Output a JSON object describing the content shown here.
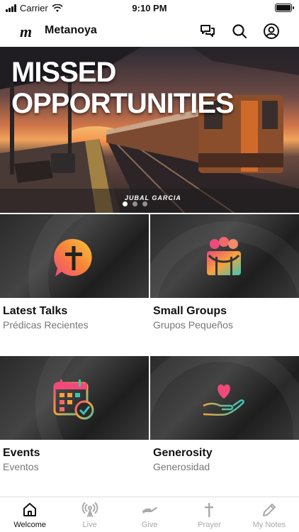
{
  "status_bar": {
    "carrier": "Carrier",
    "time": "9:10 PM"
  },
  "header": {
    "logo": "m",
    "title": "Metanoya"
  },
  "hero": {
    "title_line1": "MISSED",
    "title_line2": "OPPORTUNITIES",
    "credit": "JUBAL GARCIA",
    "page_count": 3,
    "active_page": 1
  },
  "tiles": [
    {
      "title": "Latest Talks",
      "subtitle": "Prédicas Recientes",
      "icon": "speech-cross-icon"
    },
    {
      "title": "Small Groups",
      "subtitle": "Grupos Pequeños",
      "icon": "group-hug-icon"
    },
    {
      "title": "Events",
      "subtitle": "Eventos",
      "icon": "calendar-check-icon"
    },
    {
      "title": "Generosity",
      "subtitle": "Generosidad",
      "icon": "heart-hand-icon"
    }
  ],
  "tab_bar": [
    {
      "label": "Welcome",
      "icon": "home-icon",
      "active": true
    },
    {
      "label": "Live",
      "icon": "broadcast-icon",
      "active": false
    },
    {
      "label": "Give",
      "icon": "give-hand-icon",
      "active": false
    },
    {
      "label": "Prayer",
      "icon": "cross-icon",
      "active": false
    },
    {
      "label": "My Notes",
      "icon": "pencil-icon",
      "active": false
    }
  ],
  "colors": {
    "accent_gradient_start": "#f04a7a",
    "accent_gradient_mid": "#f7a33a",
    "accent_gradient_end": "#38c6b8"
  }
}
